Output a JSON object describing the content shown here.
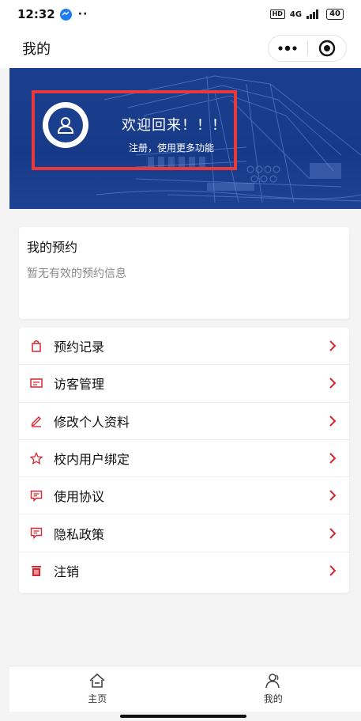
{
  "status_bar": {
    "time": "12:32",
    "dots": "··",
    "hd": "HD",
    "network": "4G",
    "battery": "40"
  },
  "nav": {
    "title": "我的"
  },
  "banner": {
    "welcome": "欢迎回来！！！",
    "subtitle": "注册，使用更多功能"
  },
  "booking": {
    "title": "我的预约",
    "empty_text": "暂无有效的预约信息"
  },
  "menu": {
    "accent_color": "#d7262f",
    "items": [
      {
        "label": "预约记录",
        "icon": "bag-icon"
      },
      {
        "label": "访客管理",
        "icon": "card-icon"
      },
      {
        "label": "修改个人资料",
        "icon": "pencil-icon"
      },
      {
        "label": "校内用户绑定",
        "icon": "star-icon"
      },
      {
        "label": "使用协议",
        "icon": "message-icon"
      },
      {
        "label": "隐私政策",
        "icon": "message-icon"
      },
      {
        "label": "注销",
        "icon": "trash-icon"
      }
    ]
  },
  "tabs": [
    {
      "label": "主页",
      "icon": "home-icon"
    },
    {
      "label": "我的",
      "icon": "user-icon"
    }
  ]
}
